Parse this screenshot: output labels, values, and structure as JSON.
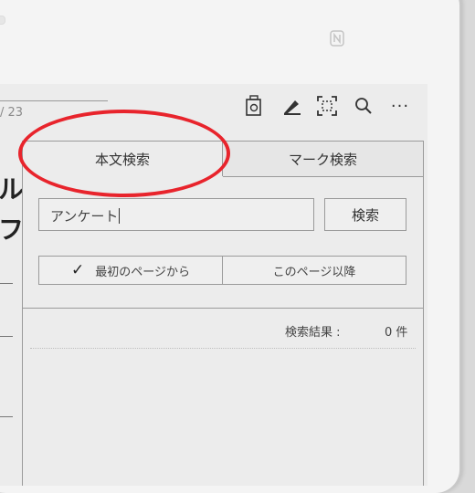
{
  "device": {
    "nfc_mark": "N"
  },
  "reader": {
    "page_indicator": "/ 23",
    "book_fragments": [
      "ル",
      "フ"
    ]
  },
  "toolbar": {
    "icons": [
      "bookmark-list-icon",
      "pen-icon",
      "fit-screen-icon",
      "search-icon",
      "more-icon"
    ],
    "more_label": "···"
  },
  "search_panel": {
    "tabs": [
      {
        "label": "本文検索",
        "active": true
      },
      {
        "label": "マーク検索",
        "active": false
      }
    ],
    "query": "アンケート",
    "search_button": "検索",
    "scope_options": [
      {
        "label": "最初のページから",
        "selected": true
      },
      {
        "label": "このページ以降",
        "selected": false
      }
    ],
    "check_mark": "✓",
    "result_label": "検索結果 :",
    "result_count": "0 件"
  },
  "annotation": {
    "color": "#e8242c"
  }
}
